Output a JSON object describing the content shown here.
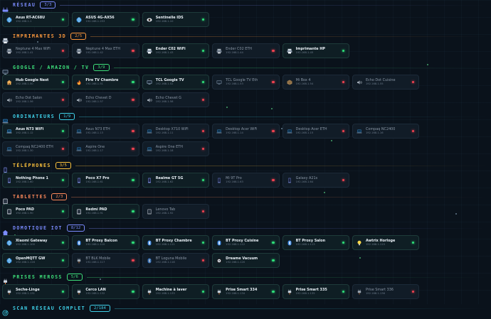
{
  "sections": [
    {
      "id": "reseau",
      "title": "Réseau",
      "count": "3/3",
      "color": "#7b8cff",
      "icon": "router",
      "devices": [
        {
          "name": "Asus RT-AC68U",
          "ip": "192.168.1.1",
          "status": "on",
          "icon": "globe"
        },
        {
          "name": "ASUS 4G-AX56",
          "ip": "192.168.1.253",
          "status": "on",
          "icon": "globe"
        },
        {
          "name": "Sentinelle IDS",
          "ip": "192.168.1.10",
          "status": "on",
          "icon": "eye"
        }
      ]
    },
    {
      "id": "imprimantes",
      "title": "Imprimantes 3D",
      "count": "2/5",
      "color": "#ff9a3d",
      "icon": "printer",
      "devices": [
        {
          "name": "Neptune 4 Max WiFi",
          "ip": "192.168.1.41",
          "status": "off",
          "icon": "printer"
        },
        {
          "name": "Neptune 4 Max ETH",
          "ip": "192.168.1.42",
          "status": "off",
          "icon": "printer"
        },
        {
          "name": "Ender C02 WiFi",
          "ip": "192.168.1.43",
          "status": "on",
          "icon": "printer"
        },
        {
          "name": "Ender C02 ETH",
          "ip": "192.168.1.44",
          "status": "off",
          "icon": "printer"
        },
        {
          "name": "Imprimante HP",
          "ip": "192.168.1.45",
          "status": "on",
          "icon": "printer"
        }
      ]
    },
    {
      "id": "google",
      "title": "Google / Amazon / TV",
      "count": "3/9",
      "color": "#3ee07b",
      "icon": "tv",
      "devices": [
        {
          "name": "Hub Google Nest",
          "ip": "192.168.1.50",
          "status": "on",
          "icon": "house"
        },
        {
          "name": "Fire TV Chambre",
          "ip": "192.168.1.51",
          "status": "on",
          "icon": "fire"
        },
        {
          "name": "TCL Google TV",
          "ip": "192.168.1.52",
          "status": "on",
          "icon": "tv"
        },
        {
          "name": "TCL Google TV Eth",
          "ip": "192.168.1.53",
          "status": "off",
          "icon": "tv"
        },
        {
          "name": "Mi Box 4",
          "ip": "192.168.1.54",
          "status": "off",
          "icon": "box"
        },
        {
          "name": "Echo Dot Cuisine",
          "ip": "192.168.1.55",
          "status": "off",
          "icon": "speaker"
        },
        {
          "name": "Echo Dot Salon",
          "ip": "192.168.1.56",
          "status": "off",
          "icon": "speaker"
        },
        {
          "name": "Echo Chevet D",
          "ip": "192.168.1.57",
          "status": "off",
          "icon": "speaker"
        },
        {
          "name": "Echo Chevet G",
          "ip": "192.168.1.58",
          "status": "off",
          "icon": "speaker"
        }
      ]
    },
    {
      "id": "ordinateurs",
      "title": "Ordinateurs",
      "count": "1/9",
      "color": "#3fd0e8",
      "icon": "laptop",
      "devices": [
        {
          "name": "Asus N73 WiFi",
          "ip": "192.168.1.12",
          "status": "on",
          "icon": "laptop"
        },
        {
          "name": "Asus N73 ETH",
          "ip": "192.168.1.13",
          "status": "off",
          "icon": "laptop"
        },
        {
          "name": "Desktop X710 WiFi",
          "ip": "192.168.1.11",
          "status": "off",
          "icon": "laptop"
        },
        {
          "name": "Desktop Acer WiFi",
          "ip": "192.168.1.14",
          "status": "off",
          "icon": "laptop"
        },
        {
          "name": "Desktop Acer ETH",
          "ip": "192.168.1.15",
          "status": "off",
          "icon": "laptop"
        },
        {
          "name": "Compaq NC2400",
          "ip": "192.168.1.16",
          "status": "off",
          "icon": "laptop"
        },
        {
          "name": "Compaq NC2400 ETH",
          "ip": "192.168.1.30",
          "status": "off",
          "icon": "laptop"
        },
        {
          "name": "Aspire One",
          "ip": "192.168.1.17",
          "status": "off",
          "icon": "laptop"
        },
        {
          "name": "Aspire One ETH",
          "ip": "192.168.1.18",
          "status": "off",
          "icon": "laptop"
        }
      ]
    },
    {
      "id": "telephones",
      "title": "Téléphones",
      "count": "3/5",
      "color": "#ffc43d",
      "icon": "phone",
      "devices": [
        {
          "name": "Nothing Phone 1",
          "ip": "192.168.1.60",
          "status": "on",
          "icon": "phone"
        },
        {
          "name": "Poco X7 Pro",
          "ip": "192.168.1.61",
          "status": "on",
          "icon": "phone"
        },
        {
          "name": "Realme GT 5G",
          "ip": "192.168.1.62",
          "status": "on",
          "icon": "phone"
        },
        {
          "name": "Mi 9T Pro",
          "ip": "192.168.1.63",
          "status": "off",
          "icon": "phone"
        },
        {
          "name": "Galaxy A21s",
          "ip": "192.168.1.64",
          "status": "off",
          "icon": "phone"
        }
      ]
    },
    {
      "id": "tablettes",
      "title": "Tablettes",
      "count": "2/3",
      "color": "#ff8a5b",
      "icon": "tablet",
      "devices": [
        {
          "name": "Poco PAD",
          "ip": "192.168.1.90",
          "status": "on",
          "icon": "tablet"
        },
        {
          "name": "Redmi PAD",
          "ip": "192.168.1.91",
          "status": "on",
          "icon": "tablet"
        },
        {
          "name": "Lenovo Tab",
          "ip": "192.168.1.92",
          "status": "off",
          "icon": "tablet"
        }
      ]
    },
    {
      "id": "domotique",
      "title": "Domotique IoT",
      "count": "8/12",
      "color": "#7b8cff",
      "icon": "home",
      "devices": [
        {
          "name": "Xiaomi Gateway",
          "ip": "192.168.1.100",
          "status": "on",
          "icon": "globe"
        },
        {
          "name": "BT Proxy Balcon",
          "ip": "192.168.1.110",
          "status": "on",
          "icon": "bluetooth"
        },
        {
          "name": "BT Proxy Chambre",
          "ip": "192.168.1.111",
          "status": "on",
          "icon": "bluetooth"
        },
        {
          "name": "BT Proxy Cuisine",
          "ip": "192.168.1.112",
          "status": "on",
          "icon": "bluetooth"
        },
        {
          "name": "BT Proxy Salon",
          "ip": "192.168.1.113",
          "status": "on",
          "icon": "bluetooth"
        },
        {
          "name": "Awtrix Horloge",
          "ip": "192.168.1.115",
          "status": "on",
          "icon": "bulb"
        },
        {
          "name": "OpenMQTT GW",
          "ip": "192.168.1.116",
          "status": "on",
          "icon": "globe"
        },
        {
          "name": "BT BLK Mobile",
          "ip": "192.168.1.117",
          "status": "off",
          "icon": "plug"
        },
        {
          "name": "BT Loguna Mobile",
          "ip": "192.168.1.118",
          "status": "off",
          "icon": "bluetooth"
        },
        {
          "name": "Dreame Vacuum",
          "ip": "192.168.1.120",
          "status": "on",
          "icon": "robot"
        }
      ]
    },
    {
      "id": "prises",
      "title": "Prises Meross",
      "count": "5/6",
      "color": "#3ee07b",
      "icon": "plug",
      "devices": [
        {
          "name": "Seche-Linge",
          "ip": "192.168.1.131",
          "status": "on",
          "icon": "plug"
        },
        {
          "name": "Cerco LAN",
          "ip": "192.168.1.132",
          "status": "on",
          "icon": "plug"
        },
        {
          "name": "Machine à laver",
          "ip": "192.168.1.133",
          "status": "on",
          "icon": "plug"
        },
        {
          "name": "Prise Smart 334",
          "ip": "192.168.1.134",
          "status": "on",
          "icon": "plug"
        },
        {
          "name": "Prise Smart 335",
          "ip": "192.168.1.135",
          "status": "on",
          "icon": "plug"
        },
        {
          "name": "Prise Smart 336",
          "ip": "192.168.1.136",
          "status": "off",
          "icon": "plug"
        }
      ]
    },
    {
      "id": "scan",
      "title": "Scan réseau complet",
      "count": "2/184",
      "color": "#3fd0e8",
      "icon": "radar",
      "devices": []
    }
  ],
  "colors": {
    "online": "#2ee07a",
    "offline": "#f04250"
  }
}
